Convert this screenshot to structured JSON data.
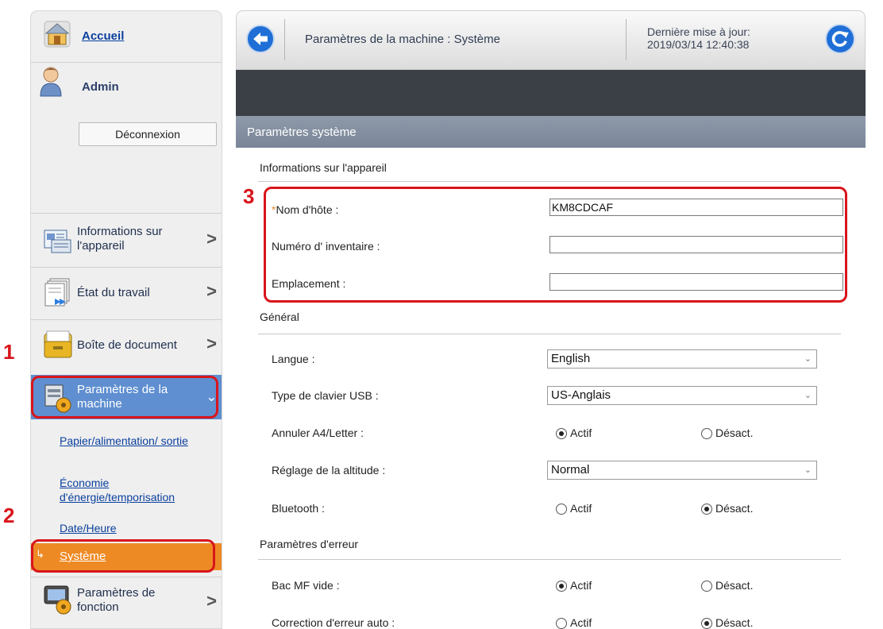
{
  "sidebar": {
    "home_label": "Accueil",
    "user_label": "Admin",
    "logout_label": "Déconnexion",
    "nav": {
      "device_info": "Informations sur l'appareil",
      "job_status": "État du travail",
      "document_box": "Boîte de document",
      "machine_settings": "Paramètres de la machine",
      "function_settings": "Paramètres de fonction"
    },
    "sub": {
      "paper": "Papier/alimentation/ sortie",
      "energy": "Économie d'énergie/temporisation",
      "datetime": "Date/Heure",
      "system": "Système"
    }
  },
  "header": {
    "title": "Paramètres de la machine : Système",
    "update_label": "Dernière mise à jour:",
    "update_time": "2019/03/14 12:40:38"
  },
  "main": {
    "section_title": "Paramètres système",
    "device_group": "Informations sur l'appareil",
    "hostname_label": "Nom d'hôte :",
    "hostname_value": "KM8CDCAF",
    "asset_label": "Numéro d' inventaire :",
    "asset_value": "",
    "location_label": "Emplacement :",
    "location_value": "",
    "general_group": "Général",
    "language_label": "Langue :",
    "language_value": "English",
    "usb_kb_label": "Type de clavier USB :",
    "usb_kb_value": "US-Anglais",
    "a4letter_label": "Annuler A4/Letter :",
    "altitude_label": "Réglage de la altitude :",
    "altitude_value": "Normal",
    "bluetooth_label": "Bluetooth :",
    "error_group": "Paramètres d'erreur",
    "mf_empty_label": "Bac MF vide :",
    "auto_correct_label": "Correction d'erreur auto :",
    "on_label": "Actif",
    "off_label": "Désact."
  },
  "steps": [
    "1",
    "2",
    "3"
  ],
  "colors": {
    "accent_blue": "#1f6fd6",
    "active_nav": "#5f8fd0",
    "active_sub": "#ee8a24",
    "callout_red": "#d8151b"
  }
}
